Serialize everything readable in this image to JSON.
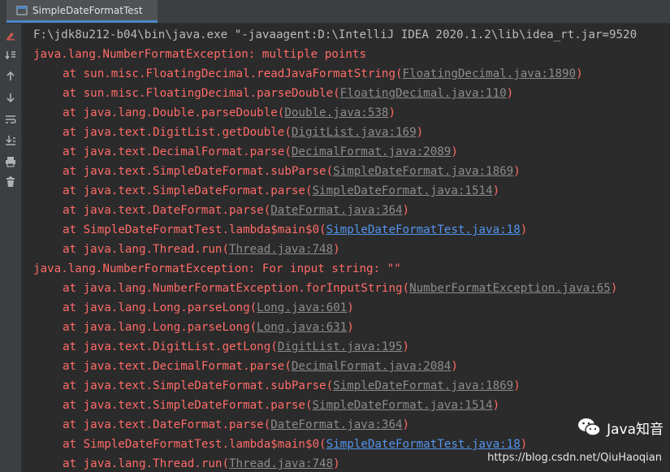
{
  "tab": {
    "title": "SimpleDateFormatTest"
  },
  "gutter": {
    "buttons": [
      "rerun-icon",
      "scroll-to-end-icon",
      "up-arrow-icon",
      "down-arrow-icon",
      "soft-wrap-icon",
      "scroll-to-bottom-icon",
      "print-icon",
      "trash-icon"
    ]
  },
  "console": {
    "lines": [
      {
        "kind": "cmd",
        "text": "F:\\jdk8u212-b04\\bin\\java.exe \"-javaagent:D:\\IntelliJ IDEA 2020.1.2\\lib\\idea_rt.jar=9520"
      },
      {
        "kind": "exception",
        "text": "java.lang.NumberFormatException: multiple points"
      },
      {
        "kind": "frame",
        "prefix": "at sun.misc.FloatingDecimal.readJavaFormatString(",
        "loc": "FloatingDecimal.java:1890",
        "suffix": ")"
      },
      {
        "kind": "frame",
        "prefix": "at sun.misc.FloatingDecimal.parseDouble(",
        "loc": "FloatingDecimal.java:110",
        "suffix": ")"
      },
      {
        "kind": "frame",
        "prefix": "at java.lang.Double.parseDouble(",
        "loc": "Double.java:538",
        "suffix": ")"
      },
      {
        "kind": "frame",
        "prefix": "at java.text.DigitList.getDouble(",
        "loc": "DigitList.java:169",
        "suffix": ")"
      },
      {
        "kind": "frame",
        "prefix": "at java.text.DecimalFormat.parse(",
        "loc": "DecimalFormat.java:2089",
        "suffix": ")"
      },
      {
        "kind": "frame",
        "prefix": "at java.text.SimpleDateFormat.subParse(",
        "loc": "SimpleDateFormat.java:1869",
        "suffix": ")"
      },
      {
        "kind": "frame",
        "prefix": "at java.text.SimpleDateFormat.parse(",
        "loc": "SimpleDateFormat.java:1514",
        "suffix": ")"
      },
      {
        "kind": "frame",
        "prefix": "at java.text.DateFormat.parse(",
        "loc": "DateFormat.java:364",
        "suffix": ")"
      },
      {
        "kind": "frame",
        "prefix": "at SimpleDateFormatTest.lambda$main$0(",
        "loc": "SimpleDateFormatTest.java:18",
        "suffix": ")",
        "user": true
      },
      {
        "kind": "frame",
        "prefix": "at java.lang.Thread.run(",
        "loc": "Thread.java:748",
        "suffix": ")"
      },
      {
        "kind": "exception",
        "text": "java.lang.NumberFormatException: For input string: \"\""
      },
      {
        "kind": "frame",
        "prefix": "at java.lang.NumberFormatException.forInputString(",
        "loc": "NumberFormatException.java:65",
        "suffix": ")"
      },
      {
        "kind": "frame",
        "prefix": "at java.lang.Long.parseLong(",
        "loc": "Long.java:601",
        "suffix": ")"
      },
      {
        "kind": "frame",
        "prefix": "at java.lang.Long.parseLong(",
        "loc": "Long.java:631",
        "suffix": ")"
      },
      {
        "kind": "frame",
        "prefix": "at java.text.DigitList.getLong(",
        "loc": "DigitList.java:195",
        "suffix": ")"
      },
      {
        "kind": "frame",
        "prefix": "at java.text.DecimalFormat.parse(",
        "loc": "DecimalFormat.java:2084",
        "suffix": ")"
      },
      {
        "kind": "frame",
        "prefix": "at java.text.SimpleDateFormat.subParse(",
        "loc": "SimpleDateFormat.java:1869",
        "suffix": ")"
      },
      {
        "kind": "frame",
        "prefix": "at java.text.SimpleDateFormat.parse(",
        "loc": "SimpleDateFormat.java:1514",
        "suffix": ")"
      },
      {
        "kind": "frame",
        "prefix": "at java.text.DateFormat.parse(",
        "loc": "DateFormat.java:364",
        "suffix": ")"
      },
      {
        "kind": "frame",
        "prefix": "at SimpleDateFormatTest.lambda$main$0(",
        "loc": "SimpleDateFormatTest.java:18",
        "suffix": ")",
        "user": true
      },
      {
        "kind": "frame",
        "prefix": "at java.lang.Thread.run(",
        "loc": "Thread.java:748",
        "suffix": ")"
      }
    ]
  },
  "watermark": {
    "brand": "Java知音",
    "url": "https://blog.csdn.net/QiuHaoqian"
  },
  "colors": {
    "error": "#ff6b68",
    "link": "#8c8c8c",
    "user_link": "#5394ec",
    "command": "#bbbbbb",
    "background": "#2b2b2b"
  }
}
